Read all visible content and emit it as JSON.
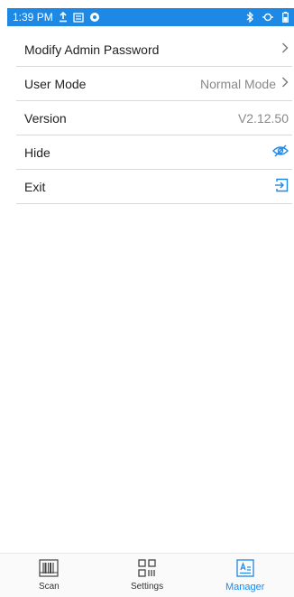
{
  "status_bar": {
    "time": "1:39 PM",
    "icons": [
      "upload-icon",
      "notification-icon",
      "app-icon",
      "bluetooth-icon",
      "nfc-icon",
      "battery-icon"
    ]
  },
  "settings": {
    "items": [
      {
        "label": "Modify Admin Password",
        "value": "",
        "trailing": "chevron-right-icon"
      },
      {
        "label": "User Mode",
        "value": "Normal Mode",
        "trailing": "chevron-right-icon"
      },
      {
        "label": "Version",
        "value": "V2.12.50",
        "trailing": ""
      },
      {
        "label": "Hide",
        "value": "",
        "trailing": "eye-off-icon"
      },
      {
        "label": "Exit",
        "value": "",
        "trailing": "exit-icon"
      }
    ]
  },
  "bottom_nav": {
    "items": [
      {
        "label": "Scan",
        "icon": "barcode-icon"
      },
      {
        "label": "Settings",
        "icon": "qr-code-icon"
      },
      {
        "label": "Manager",
        "icon": "manager-icon"
      }
    ],
    "active": "Manager"
  },
  "colors": {
    "accent": "#1e88e5",
    "divider": "#d9d9d9",
    "text": "#222222",
    "secondary_text": "#888888"
  }
}
